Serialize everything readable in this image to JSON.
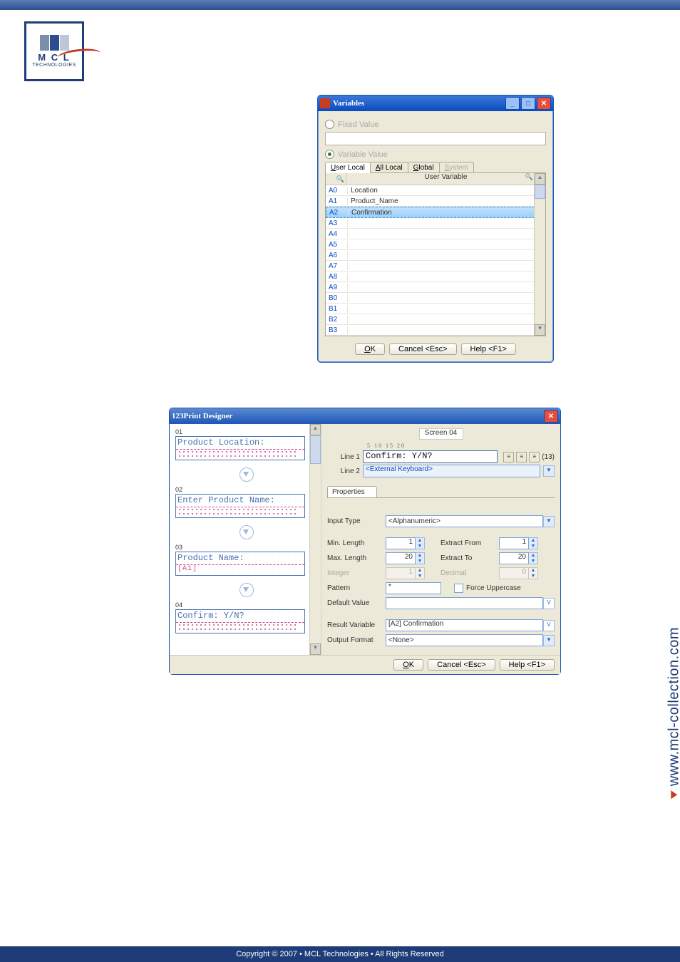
{
  "logo": {
    "line1": "M C L",
    "line2": "TECHNOLOGIES"
  },
  "side_url": "www.mcl-collection.com",
  "footer": "Copyright © 2007 • MCL Technologies • All Rights Reserved",
  "vars_win": {
    "title": "Variables",
    "fixed_value_label": "Fixed Value",
    "variable_value_label": "Variable Value",
    "tabs": {
      "user_local": "User Local",
      "all_local": "All Local",
      "global": "Global",
      "system": "System"
    },
    "column_header": "User Variable",
    "rows": [
      {
        "id": "A0",
        "name": "Location"
      },
      {
        "id": "A1",
        "name": "Product_Name"
      },
      {
        "id": "A2",
        "name": "Confirmation"
      },
      {
        "id": "A3",
        "name": ""
      },
      {
        "id": "A4",
        "name": ""
      },
      {
        "id": "A5",
        "name": ""
      },
      {
        "id": "A6",
        "name": ""
      },
      {
        "id": "A7",
        "name": ""
      },
      {
        "id": "A8",
        "name": ""
      },
      {
        "id": "A9",
        "name": ""
      },
      {
        "id": "B0",
        "name": ""
      },
      {
        "id": "B1",
        "name": ""
      },
      {
        "id": "B2",
        "name": ""
      },
      {
        "id": "B3",
        "name": ""
      }
    ],
    "selected_index": 2,
    "buttons": {
      "ok": "OK",
      "cancel": "Cancel <Esc>",
      "help": "Help <F1>"
    }
  },
  "pd_win": {
    "title": "123Print Designer",
    "screens": [
      {
        "num": "01",
        "l1": "Product Location:",
        "l2_dots": true
      },
      {
        "num": "02",
        "l1": "Enter Product Name:",
        "l2_dots": true
      },
      {
        "num": "03",
        "l1": "Product Name:",
        "l2": "[A1]"
      },
      {
        "num": "04",
        "l1": "Confirm: Y/N?",
        "l2_dots": true
      }
    ],
    "right": {
      "screen_label": "Screen 04",
      "ruler": "5        10        15        20",
      "line1_label": "Line 1",
      "line1_value": "Confirm: Y/N?",
      "char_count": "(13)",
      "line2_label": "Line 2",
      "line2_value": "<External Keyboard>",
      "properties_tab": "Properties",
      "input_type_label": "Input Type",
      "input_type_value": "<Alphanumeric>",
      "min_len_label": "Min. Length",
      "min_len_value": "1",
      "extract_from_label": "Extract From",
      "extract_from_value": "1",
      "max_len_label": "Max. Length",
      "max_len_value": "20",
      "extract_to_label": "Extract To",
      "extract_to_value": "20",
      "integer_label": "Integer",
      "integer_value": "1",
      "decimal_label": "Decimal",
      "decimal_value": "0",
      "pattern_label": "Pattern",
      "pattern_value": "*",
      "force_upper_label": "Force Uppercase",
      "default_label": "Default Value",
      "default_value": "",
      "result_var_label": "Result Variable",
      "result_var_value": "[A2] Confirmation",
      "output_fmt_label": "Output Format",
      "output_fmt_value": "<None>"
    },
    "buttons": {
      "ok": "OK",
      "cancel": "Cancel <Esc>",
      "help": "Help <F1>"
    }
  }
}
